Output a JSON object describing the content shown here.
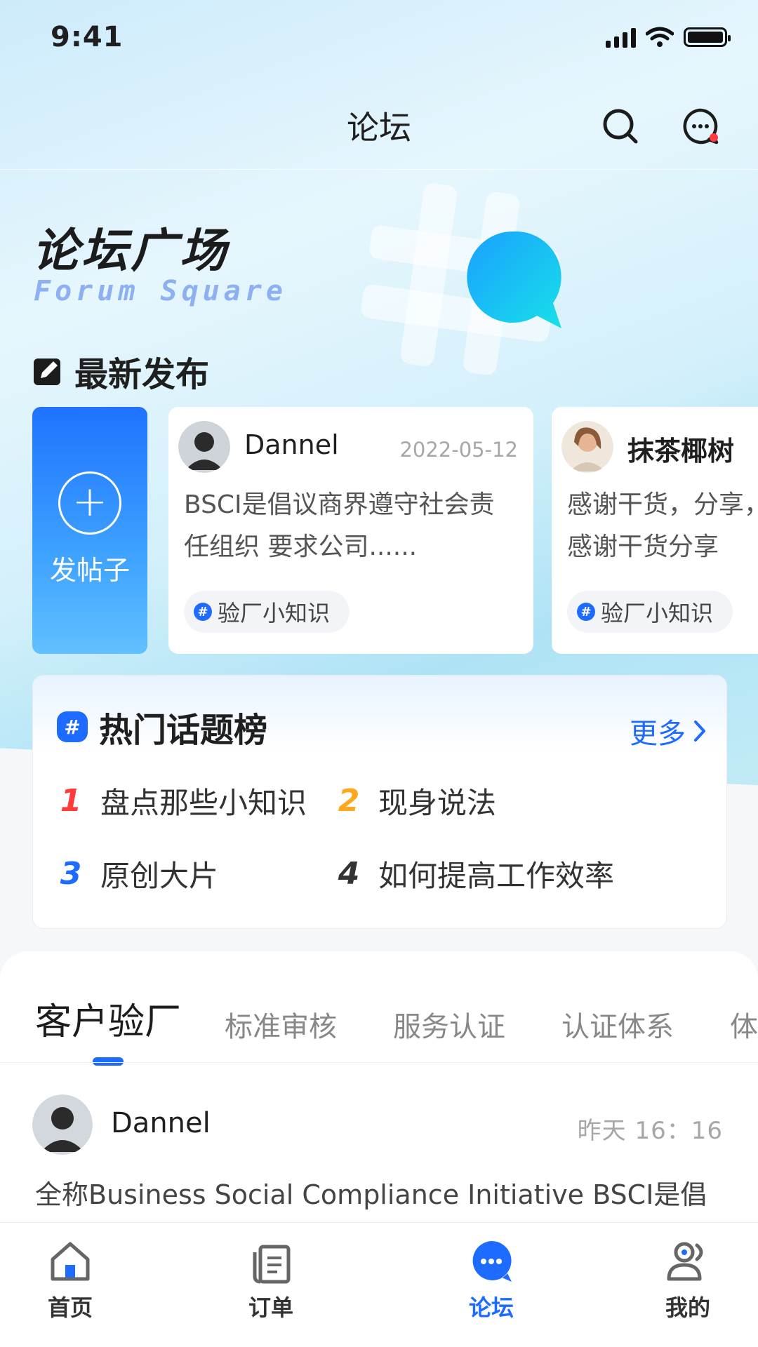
{
  "status_bar": {
    "time": "9:41"
  },
  "nav": {
    "title": "论坛"
  },
  "hero": {
    "title": "论坛广场",
    "subtitle": "Forum Square"
  },
  "latest": {
    "heading": "最新发布",
    "post_button_label": "发帖子",
    "cards": [
      {
        "name": "Dannel",
        "date": "2022-05-12",
        "text": "BSCI是倡议商界遵守社会责任组织 要求公司......",
        "tag": "验厂小知识"
      },
      {
        "name": "抹茶椰树",
        "date": "",
        "text": "感谢干货，分享，感谢干货分享",
        "tag": "验厂小知识"
      }
    ]
  },
  "hot_topics": {
    "heading": "热门话题榜",
    "more_label": "更多",
    "items": [
      {
        "rank": "1",
        "label": "盘点那些小知识",
        "color": "#ff3b3b"
      },
      {
        "rank": "2",
        "label": "现身说法",
        "color": "#ffa81f"
      },
      {
        "rank": "3",
        "label": "原创大片",
        "color": "#1e6bff"
      },
      {
        "rank": "4",
        "label": "如何提高工作效率",
        "color": "#333333"
      }
    ]
  },
  "feed_tabs": [
    "客户验厂",
    "标准审核",
    "服务认证",
    "认证体系",
    "体"
  ],
  "feed": {
    "name": "Dannel",
    "time": "昨天  16：16",
    "text": "全称Business Social Compliance Initiative BSCI是倡"
  },
  "tabbar": [
    {
      "label": "首页",
      "icon": "home-icon",
      "active": false
    },
    {
      "label": "订单",
      "icon": "order-icon",
      "active": false
    },
    {
      "label": "论坛",
      "icon": "forum-icon",
      "active": true
    },
    {
      "label": "我的",
      "icon": "profile-icon",
      "active": false
    }
  ],
  "colors": {
    "accent": "#1e6bff",
    "notification_dot": "#ff3b3b"
  }
}
